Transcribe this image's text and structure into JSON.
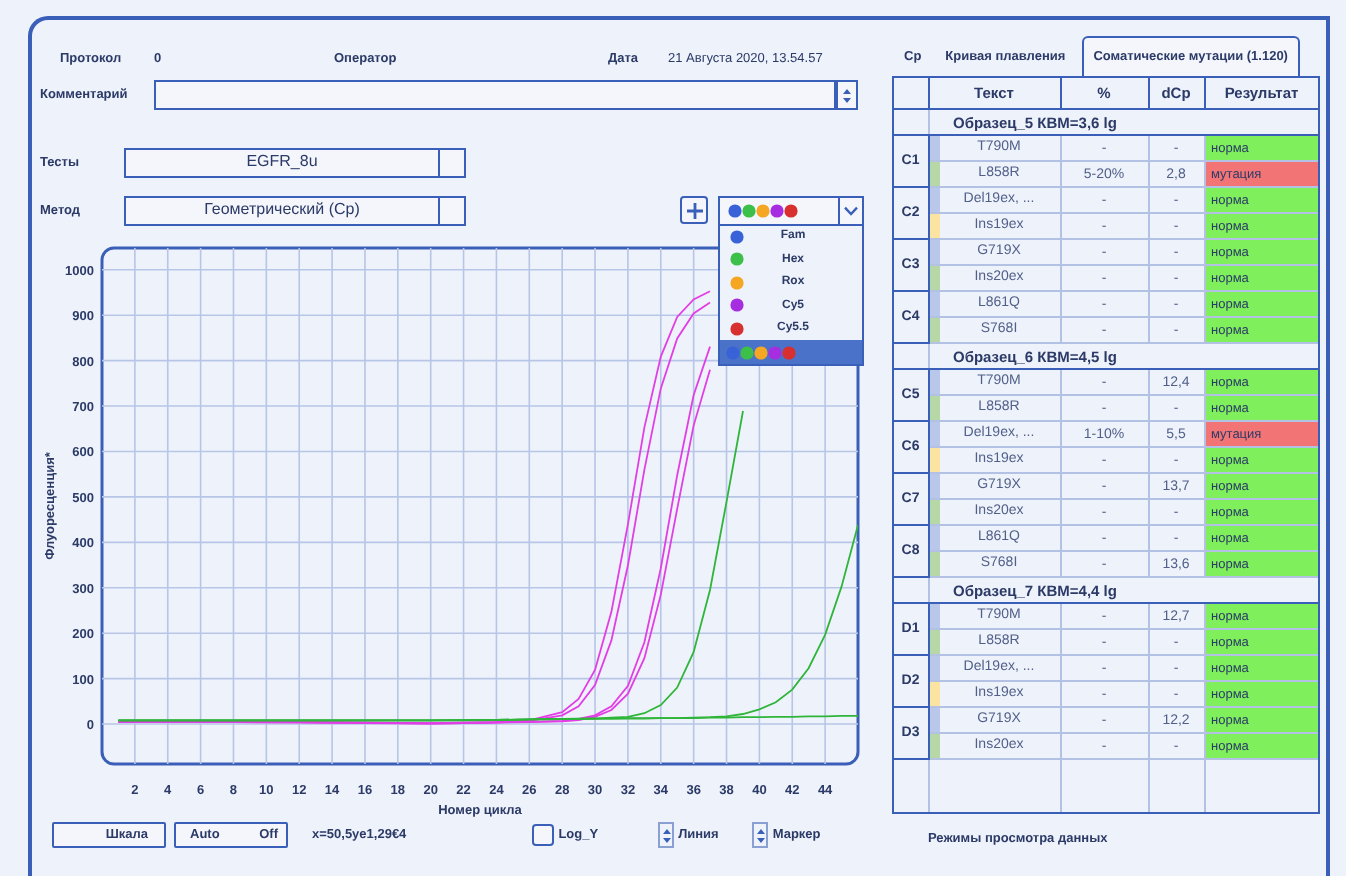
{
  "header": {
    "protocol_label": "Протокол",
    "protocol_value": "0",
    "operator_label": "Оператор",
    "date_label": "Дата",
    "date_value": "21 Августа 2020, 13.54.57"
  },
  "comment": {
    "label": "Комментарий"
  },
  "tests": {
    "label": "Тесты",
    "value": "EGFR_8u"
  },
  "method": {
    "label": "Метод",
    "value": "Геометрический (Cp)"
  },
  "channel_menu": {
    "items": [
      {
        "kind": "channel",
        "label": "Fam",
        "color": "#3a62d8",
        "selected": false
      },
      {
        "kind": "channel",
        "label": "Hex",
        "color": "#3cc04a",
        "selected": false
      },
      {
        "kind": "channel",
        "label": "Rox",
        "color": "#f5a623",
        "selected": false
      },
      {
        "kind": "channel",
        "label": "Cy5",
        "color": "#a62ee0",
        "selected": false
      },
      {
        "kind": "channel",
        "label": "Cy5.5",
        "color": "#d83030",
        "selected": false
      },
      {
        "kind": "all",
        "selected": true
      }
    ]
  },
  "chart": {
    "chart_data": {
      "type": "line",
      "xlabel": "Номер цикла",
      "ylabel": "Флуоресценция*",
      "x": [
        1,
        4,
        8,
        12,
        16,
        20,
        24,
        26,
        28,
        29,
        30,
        31,
        32,
        33,
        34,
        35,
        36,
        37,
        38,
        39,
        40,
        41,
        42,
        43,
        44,
        45,
        46
      ],
      "series": [
        {
          "color": "#e23ee6",
          "values": [
            5,
            5,
            5,
            4,
            3,
            2,
            4,
            8,
            26,
            55,
            119,
            247,
            441,
            653,
            809,
            896,
            935,
            953,
            null,
            null,
            null,
            null,
            null,
            null,
            null,
            null,
            null
          ]
        },
        {
          "color": "#e23ee6",
          "values": [
            6,
            6,
            5,
            4,
            3,
            1,
            3,
            7,
            19,
            39,
            86,
            184,
            350,
            560,
            739,
            849,
            904,
            928,
            null,
            null,
            null,
            null,
            null,
            null,
            null,
            null,
            null
          ]
        },
        {
          "color": "#e23ee6",
          "values": [
            5,
            5,
            5,
            4,
            3,
            2,
            4,
            5,
            7,
            11,
            19,
            39,
            84,
            180,
            343,
            548,
            724,
            831,
            null,
            null,
            null,
            null,
            null,
            null,
            null,
            null,
            null
          ]
        },
        {
          "color": "#e23ee6",
          "values": [
            4,
            4,
            4,
            3,
            2,
            1,
            3,
            4,
            6,
            9,
            16,
            31,
            67,
            145,
            285,
            474,
            657,
            780,
            null,
            null,
            null,
            null,
            null,
            null,
            null,
            null,
            null
          ]
        },
        {
          "color": "#2fb53a",
          "values": [
            8,
            8,
            8,
            8,
            8,
            8,
            9,
            10,
            11,
            12,
            12,
            14,
            16,
            24,
            42,
            80,
            158,
            295,
            490,
            689,
            null,
            null,
            null,
            null,
            null,
            null,
            null
          ]
        },
        {
          "color": "#2fb53a",
          "values": [
            8,
            8,
            8,
            8,
            8,
            8,
            9,
            10,
            11,
            11,
            12,
            12,
            13,
            13,
            13,
            13,
            14,
            15,
            17,
            22,
            32,
            48,
            76,
            123,
            197,
            303,
            438
          ]
        },
        {
          "color": "#2fb53a",
          "values": [
            8,
            8,
            8,
            8,
            8,
            8,
            9,
            10,
            11,
            11,
            12,
            12,
            12,
            12,
            13,
            13,
            13,
            14,
            14,
            15,
            15,
            16,
            16,
            17,
            17,
            18,
            18
          ]
        }
      ],
      "grid": true,
      "xlim": [
        0,
        46
      ],
      "ylim": [
        -88,
        1048
      ],
      "xticks": [
        2,
        4,
        6,
        8,
        10,
        12,
        14,
        16,
        18,
        20,
        22,
        24,
        26,
        28,
        30,
        32,
        34,
        36,
        38,
        40,
        42,
        44
      ],
      "yticks": [
        0,
        100,
        200,
        300,
        400,
        500,
        600,
        700,
        800,
        900,
        1000
      ]
    }
  },
  "controls": {
    "scale_button": "Шкала",
    "auto_label": "Auto",
    "off_label": "Off",
    "cursor_readout": "x=50,5ye1,29€4",
    "log_y": {
      "label": "Log_Y",
      "checked": false
    },
    "line_spinner": "Линия",
    "marker_spinner": "Маркер"
  },
  "tabs": [
    {
      "label": "Ср",
      "selected": false
    },
    {
      "label": "Кривая плавления",
      "selected": false
    },
    {
      "label": "Соматические мутации (1.120)",
      "selected": true
    }
  ],
  "table": {
    "columns": [
      "Текст",
      "%",
      "dCp",
      "Результат"
    ],
    "samples": [
      {
        "name": "Образец_5 КВМ=3,6 lg",
        "wells": [
          {
            "well": "C1",
            "rows": [
              {
                "target": "T790M",
                "percent": "-",
                "dcp": "-",
                "result": "норма",
                "mutation": false,
                "color": "#b9c8ea"
              },
              {
                "target": "L858R",
                "percent": "5-20%",
                "dcp": "2,8",
                "result": "мутация",
                "mutation": true,
                "color": "#b6d8a6"
              }
            ]
          },
          {
            "well": "C2",
            "rows": [
              {
                "target": "Del19ex, ...",
                "percent": "-",
                "dcp": "-",
                "result": "норма",
                "mutation": false,
                "color": "#b9c8ea"
              },
              {
                "target": "Ins19ex",
                "percent": "-",
                "dcp": "-",
                "result": "норма",
                "mutation": false,
                "color": "#fbe3a2"
              }
            ]
          },
          {
            "well": "C3",
            "rows": [
              {
                "target": "G719X",
                "percent": "-",
                "dcp": "-",
                "result": "норма",
                "mutation": false,
                "color": "#b9c8ea"
              },
              {
                "target": "Ins20ex",
                "percent": "-",
                "dcp": "-",
                "result": "норма",
                "mutation": false,
                "color": "#b6d8a6"
              }
            ]
          },
          {
            "well": "C4",
            "rows": [
              {
                "target": "L861Q",
                "percent": "-",
                "dcp": "-",
                "result": "норма",
                "mutation": false,
                "color": "#b9c8ea"
              },
              {
                "target": "S768I",
                "percent": "-",
                "dcp": "-",
                "result": "норма",
                "mutation": false,
                "color": "#b6d8a6"
              }
            ]
          }
        ]
      },
      {
        "name": "Образец_6 КВМ=4,5 lg",
        "wells": [
          {
            "well": "C5",
            "rows": [
              {
                "target": "T790M",
                "percent": "-",
                "dcp": "12,4",
                "result": "норма",
                "mutation": false,
                "color": "#b9c8ea"
              },
              {
                "target": "L858R",
                "percent": "-",
                "dcp": "-",
                "result": "норма",
                "mutation": false,
                "color": "#b6d8a6"
              }
            ]
          },
          {
            "well": "C6",
            "rows": [
              {
                "target": "Del19ex, ...",
                "percent": "1-10%",
                "dcp": "5,5",
                "result": "мутация",
                "mutation": true,
                "color": "#b9c8ea"
              },
              {
                "target": "Ins19ex",
                "percent": "-",
                "dcp": "-",
                "result": "норма",
                "mutation": false,
                "color": "#fbe3a2"
              }
            ]
          },
          {
            "well": "C7",
            "rows": [
              {
                "target": "G719X",
                "percent": "-",
                "dcp": "13,7",
                "result": "норма",
                "mutation": false,
                "color": "#b9c8ea"
              },
              {
                "target": "Ins20ex",
                "percent": "-",
                "dcp": "-",
                "result": "норма",
                "mutation": false,
                "color": "#b6d8a6"
              }
            ]
          },
          {
            "well": "C8",
            "rows": [
              {
                "target": "L861Q",
                "percent": "-",
                "dcp": "-",
                "result": "норма",
                "mutation": false,
                "color": "#b9c8ea"
              },
              {
                "target": "S768I",
                "percent": "-",
                "dcp": "13,6",
                "result": "норма",
                "mutation": false,
                "color": "#b6d8a6"
              }
            ]
          }
        ]
      },
      {
        "name": "Образец_7 КВМ=4,4 lg",
        "wells": [
          {
            "well": "D1",
            "rows": [
              {
                "target": "T790M",
                "percent": "-",
                "dcp": "12,7",
                "result": "норма",
                "mutation": false,
                "color": "#b9c8ea"
              },
              {
                "target": "L858R",
                "percent": "-",
                "dcp": "-",
                "result": "норма",
                "mutation": false,
                "color": "#b6d8a6"
              }
            ]
          },
          {
            "well": "D2",
            "rows": [
              {
                "target": "Del19ex, ...",
                "percent": "-",
                "dcp": "-",
                "result": "норма",
                "mutation": false,
                "color": "#b9c8ea"
              },
              {
                "target": "Ins19ex",
                "percent": "-",
                "dcp": "-",
                "result": "норма",
                "mutation": false,
                "color": "#fbe3a2"
              }
            ]
          },
          {
            "well": "D3",
            "rows": [
              {
                "target": "G719X",
                "percent": "-",
                "dcp": "12,2",
                "result": "норма",
                "mutation": false,
                "color": "#b9c8ea"
              },
              {
                "target": "Ins20ex",
                "percent": "-",
                "dcp": "-",
                "result": "норма",
                "mutation": false,
                "color": "#b6d8a6"
              }
            ]
          }
        ]
      }
    ]
  },
  "footer_note": "Режимы просмотра данных"
}
